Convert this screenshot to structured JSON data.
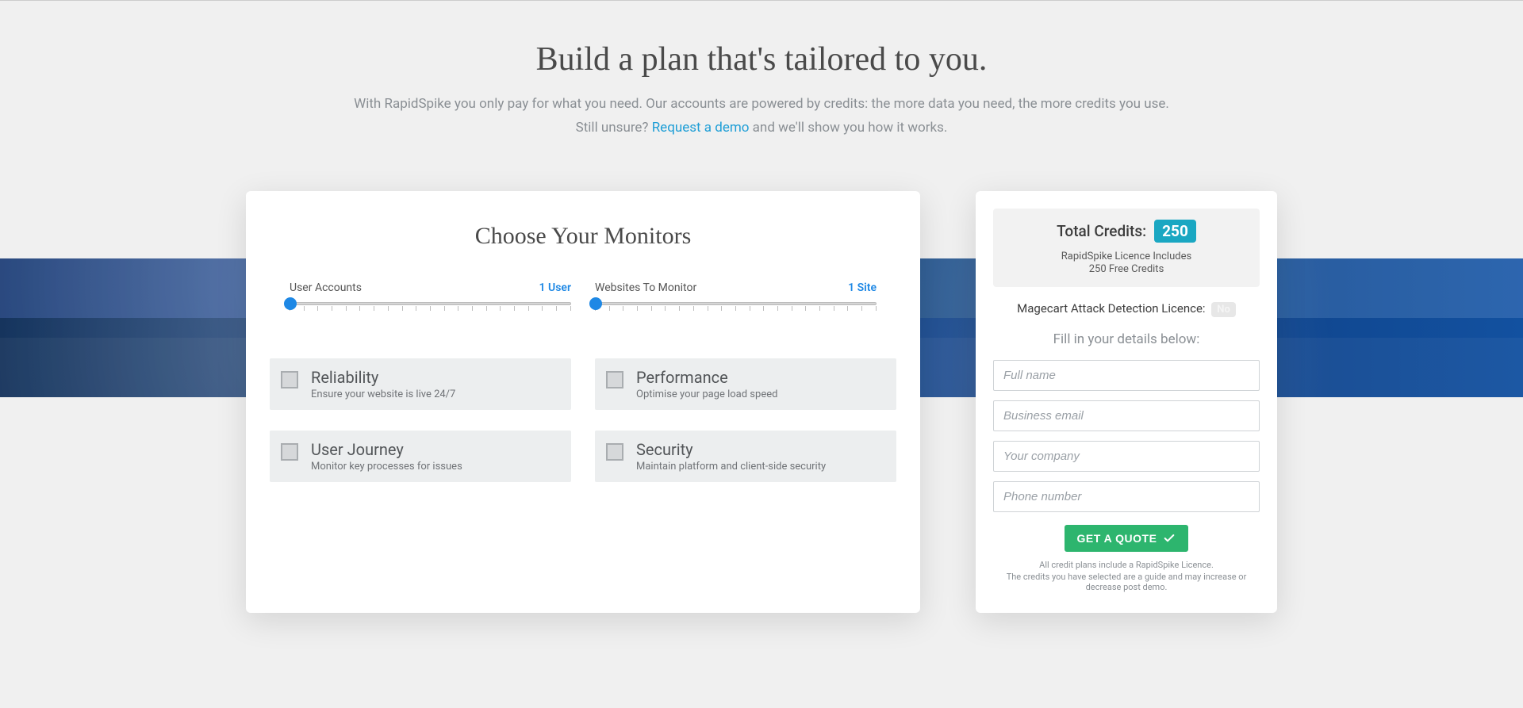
{
  "hero": {
    "title": "Build a plan that's tailored to you.",
    "sub1": "With RapidSpike you only pay for what you need. Our accounts are powered by credits: the more data you need, the more credits you use.",
    "sub2_pre": "Still unsure? ",
    "sub2_link": "Request a demo",
    "sub2_post": " and we'll show you how it works."
  },
  "left": {
    "title": "Choose Your Monitors",
    "sliders": [
      {
        "label": "User Accounts",
        "value": "1 User"
      },
      {
        "label": "Websites To Monitor",
        "value": "1 Site"
      }
    ],
    "monitors": [
      {
        "name": "Reliability",
        "desc": "Ensure your website is live 24/7"
      },
      {
        "name": "Performance",
        "desc": "Optimise your page load speed"
      },
      {
        "name": "User Journey",
        "desc": "Monitor key processes for issues"
      },
      {
        "name": "Security",
        "desc": "Maintain platform and client-side security"
      }
    ]
  },
  "right": {
    "total_label": "Total Credits:",
    "total_value": "250",
    "summary_line1": "RapidSpike Licence Includes",
    "summary_line2": "250 Free Credits",
    "magecart_label": "Magecart Attack Detection Licence:",
    "magecart_value": "No",
    "form_title": "Fill in your details below:",
    "fields": {
      "name": "Full name",
      "email": "Business email",
      "company": "Your company",
      "phone": "Phone number"
    },
    "cta": "GET A QUOTE",
    "fine1": "All credit plans include a RapidSpike Licence.",
    "fine2": "The credits you have selected are a guide and may increase or decrease post demo."
  }
}
